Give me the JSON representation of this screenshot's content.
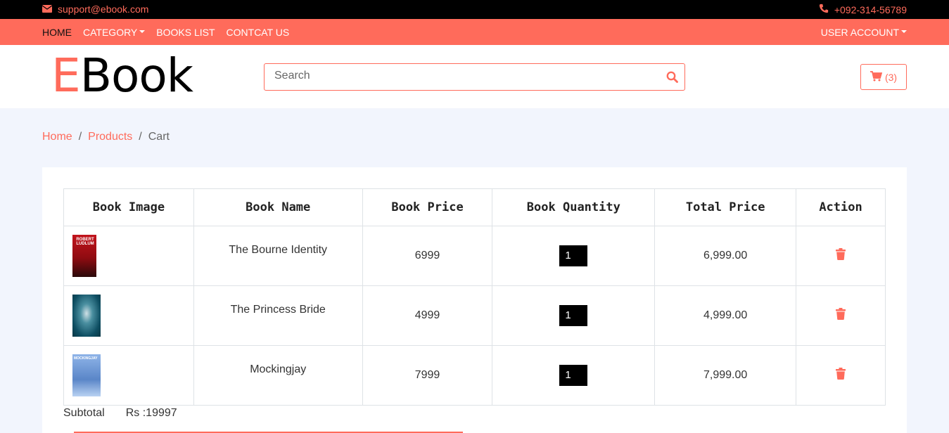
{
  "topbar": {
    "email": "support@ebook.com",
    "phone": "+092-314-56789"
  },
  "nav": {
    "items": [
      "HOME",
      "CATEGORY",
      "BOOKS LIST",
      "CONTCAT US"
    ],
    "account": "USER ACCOUNT"
  },
  "logo": {
    "first": "E",
    "rest": "Book"
  },
  "search": {
    "placeholder": "Search",
    "value": ""
  },
  "cart": {
    "count": "(3)"
  },
  "breadcrumb": {
    "home": "Home",
    "products": "Products",
    "current": "Cart",
    "separator": "/"
  },
  "table": {
    "headers": [
      "Book Image",
      "Book Name",
      "Book Price",
      "Book Quantity",
      "Total Price",
      "Action"
    ],
    "rows": [
      {
        "name": "The Bourne Identity",
        "price": "6999",
        "quantity": "1",
        "total": "6,999.00",
        "cover_text": "ROBERT LUDLUM"
      },
      {
        "name": "The Princess Bride",
        "price": "4999",
        "quantity": "1",
        "total": "4,999.00",
        "cover_text": ""
      },
      {
        "name": "Mockingjay",
        "price": "7999",
        "quantity": "1",
        "total": "7,999.00",
        "cover_text": "MOCKINGJAY"
      }
    ]
  },
  "subtotal": {
    "label": "Subtotal",
    "value": "Rs :19997"
  },
  "colors": {
    "accent": "#ff6b5b",
    "topbar": "#000000",
    "page_bg": "#f2f5fd"
  },
  "icons": [
    "envelope-icon",
    "phone-icon",
    "search-icon",
    "cart-icon",
    "trash-icon"
  ]
}
